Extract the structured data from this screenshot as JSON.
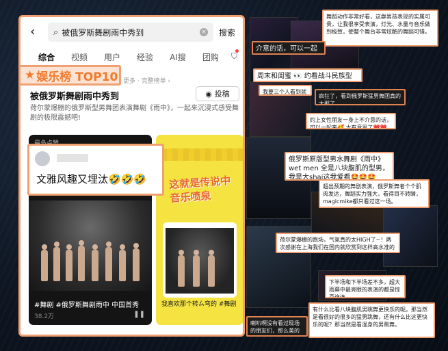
{
  "search": {
    "query": "被俄罗斯舞剧雨中秀到",
    "button": "搜索"
  },
  "tabs": [
    "综合",
    "视频",
    "用户",
    "经验",
    "AI搜",
    "团购"
  ],
  "badge": "娱乐榜 TOP10",
  "meta": "更多 · 完整榜单 ›",
  "content": {
    "title": "被俄罗斯舞剧雨中秀到",
    "post_button": "投稿",
    "desc": "荷尔蒙爆棚的俄罗斯型男舞团表演舞剧《雨中》，一起来沉浸式感受舞剧的极限震撼吧!"
  },
  "card1": {
    "top_label": "最多点赞",
    "caption": "#舞剧 #俄罗斯舞剧雨中 中国首秀",
    "likes": "38.2万"
  },
  "card2": {
    "headline": "这就是传说中\n音乐喷泉",
    "caption": "我喜欢那个转ㄙ弯的 #舞剧"
  },
  "comment": {
    "text": "文雅风趣又埋汰🤣🤣🤣"
  },
  "notes": [
    {
      "id": "n1",
      "text": "舞蹈动作非常好看，这群男孩表现的实属可贵，让我很享受表演，灯光、水量与音乐做到极致，使整个舞台非常炫酷的舞蹈可惜。"
    },
    {
      "id": "n2",
      "text": "介意的话，可以一起来🥰"
    },
    {
      "id": "n3",
      "text": "周末和闺蜜 👀 约看战斗民族型男雨中show"
    },
    {
      "id": "n4",
      "text": "我要三个人看到就哈哈！"
    },
    {
      "id": "n5",
      "text": "疯狂了，看到俄罗斯猛男舞团真的太那了"
    },
    {
      "id": "n6",
      "text": "约上女性朋友一身上不介意的话，可以一起来🥰 太有意思了❤️❤️❤️❤️"
    },
    {
      "id": "n7",
      "text": "俄罗斯原版型男水舞剧《雨中》wet men 全是八块腹肌的型男，我是大shai这我爱看🤩🤩🤩"
    },
    {
      "id": "n8",
      "text": "超出预期的舞剧表演，俄罗斯舞者个个肌肉发达，舞蹈实力强大，看得目不转睛，magicmike都只看过这一场。"
    },
    {
      "id": "n9",
      "text": "荷尔蒙爆棚的跑场，气氛真的太HIGH了~！两次感谢在上海我们在国内就欣赏到这样高水准的演出~！ 🤩🤩🤩"
    },
    {
      "id": "n10",
      "text": "下半场和下半场差不多，超大雨幕中最亮眼的表演的都是惊喜连连。"
    },
    {
      "id": "n11",
      "text": "有什么比看八块腹肌男跳舞更快乐的呢。那当然是看很好的很多的猛男跳舞，还有什么比这更快乐的呢？那当然是看湿身的男跳舞。"
    },
    {
      "id": "n12",
      "text": "喇叭啊没有看过现场的朋友们，那么美的舞台是世界看的。"
    }
  ],
  "colors": {
    "accent": "#f27a2c",
    "border": "#f0a070"
  }
}
